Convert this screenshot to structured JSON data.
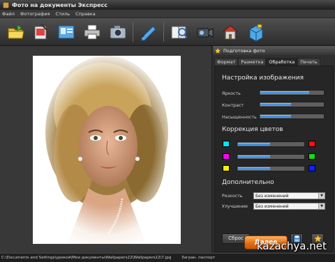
{
  "window": {
    "title": "Фото на документы Экспресс"
  },
  "menu": [
    "Файл",
    "Фотография",
    "Стиль",
    "Справка"
  ],
  "toolbar": {
    "buttons": [
      "open-folder-icon",
      "crop-icon",
      "id-card-icon",
      "printer-icon",
      "camera-icon",
      "edit-pen-icon",
      "book-zoom-icon",
      "video-camera-icon",
      "home-icon",
      "box-icon"
    ]
  },
  "panel": {
    "header": "Подготовка фото",
    "tabs": [
      "Формат",
      "Разметка",
      "Обработка",
      "Печать"
    ],
    "active_tab": "Обработка",
    "image_settings": {
      "title": "Настройка изображения",
      "sliders": [
        {
          "label": "Яркость",
          "value": 0.78
        },
        {
          "label": "Контраст",
          "value": 0.5
        },
        {
          "label": "Насыщенность",
          "value": 0.5
        }
      ]
    },
    "color_correction": {
      "title": "Коррекция цветов",
      "rows": [
        {
          "left_color": "#00e5ff",
          "right_color": "#ff1010",
          "value": 0.5
        },
        {
          "left_color": "#ff00ff",
          "right_color": "#11dd11",
          "value": 0.5
        },
        {
          "left_color": "#ffee00",
          "right_color": "#1020ff",
          "value": 0.5
        }
      ]
    },
    "extra": {
      "title": "Дополнительно",
      "sharpness_label": "Резкость",
      "sharpness_value": "Без изменений",
      "enhance_label": "Улучшение",
      "enhance_value": "Без изменений"
    },
    "reset_label": "Сброс"
  },
  "next_label": "Далее",
  "status": {
    "path": "C:\\Documents and Settings\\урекой\\Мои документы\\Wallpapers22\\Wallpapers22\\7.jpg",
    "mode": "Загран. паспорт"
  },
  "watermark": "kazachya.net",
  "colors": {
    "accent": "#2f7fd1",
    "next_button": "#e06a10",
    "background": "#2b2b2b"
  }
}
